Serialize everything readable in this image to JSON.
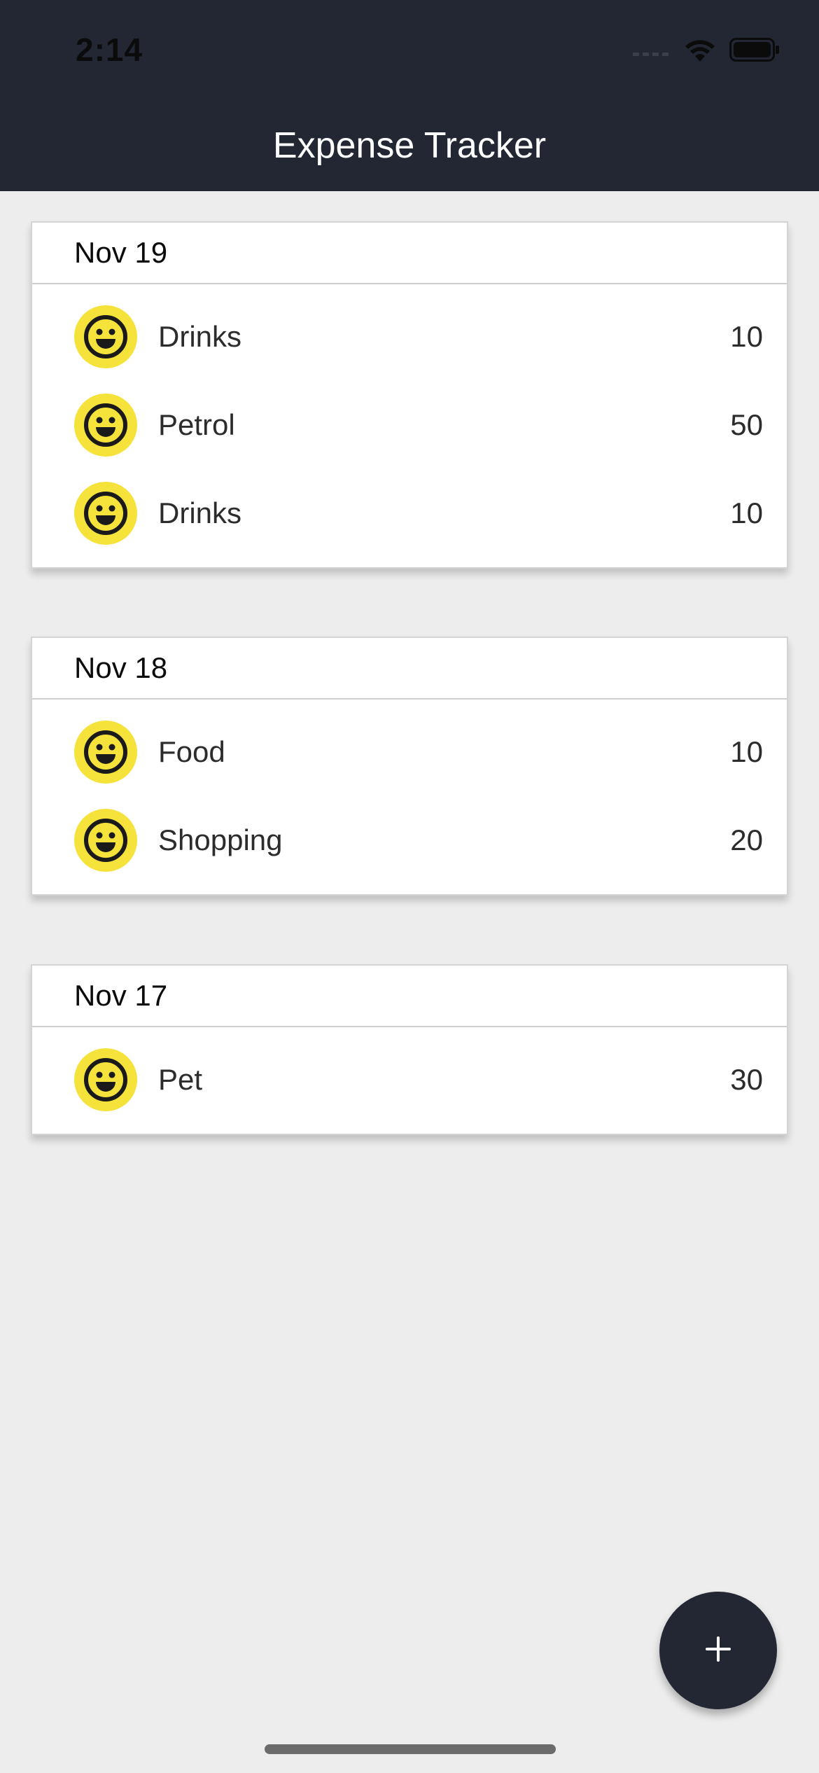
{
  "status_bar": {
    "time": "2:14",
    "icons": [
      "signal-icon",
      "wifi-icon",
      "battery-icon"
    ]
  },
  "header": {
    "title": "Expense Tracker"
  },
  "groups": [
    {
      "date": "Nov 19",
      "items": [
        {
          "name": "Drinks",
          "amount": "10",
          "icon": "smiley-icon"
        },
        {
          "name": "Petrol",
          "amount": "50",
          "icon": "smiley-icon"
        },
        {
          "name": "Drinks",
          "amount": "10",
          "icon": "smiley-icon"
        }
      ]
    },
    {
      "date": "Nov 18",
      "items": [
        {
          "name": "Food",
          "amount": "10",
          "icon": "smiley-icon"
        },
        {
          "name": "Shopping",
          "amount": "20",
          "icon": "smiley-icon"
        }
      ]
    },
    {
      "date": "Nov 17",
      "items": [
        {
          "name": "Pet",
          "amount": "30",
          "icon": "smiley-icon"
        }
      ]
    }
  ],
  "fab": {
    "icon": "plus-icon"
  },
  "colors": {
    "header_bg": "#222733",
    "page_bg": "#ededed",
    "card_bg": "#ffffff",
    "icon_yellow": "#f5e23a",
    "fab_bg": "#222733"
  }
}
